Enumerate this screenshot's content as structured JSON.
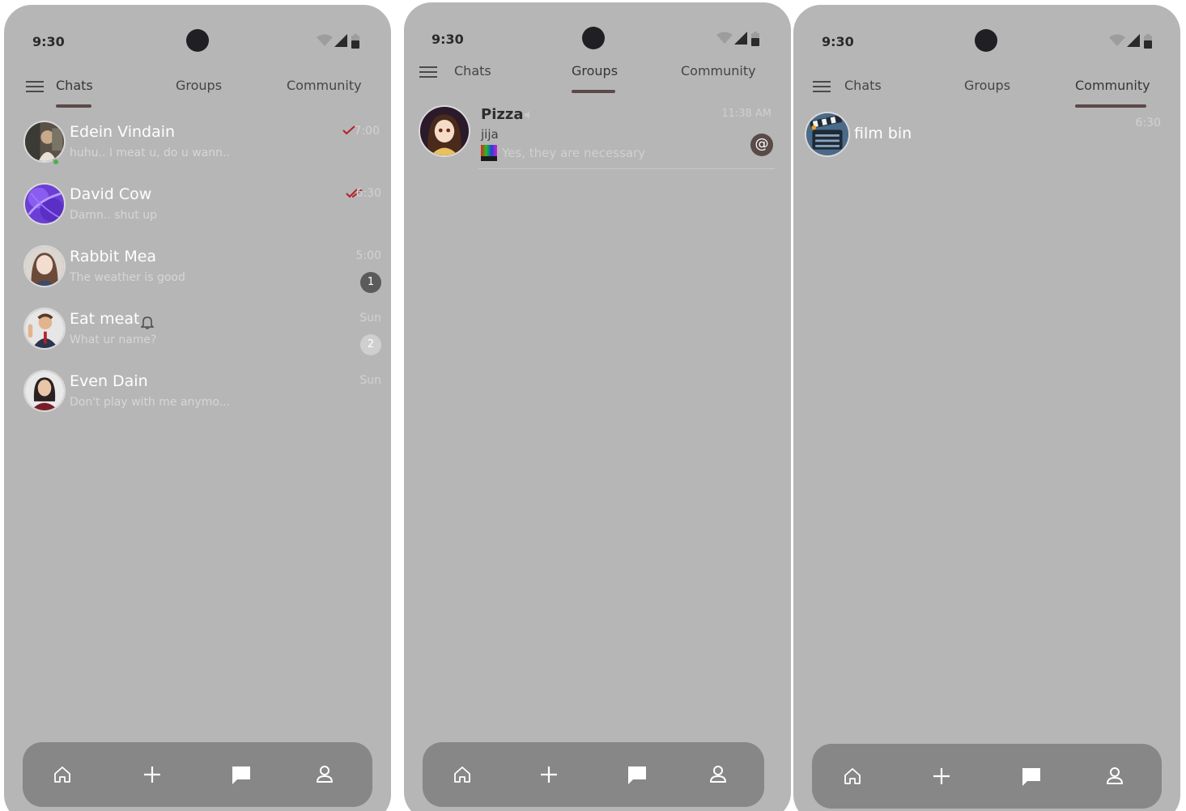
{
  "status": {
    "time": "9:30"
  },
  "tabs": {
    "chats": "Chats",
    "groups": "Groups",
    "community": "Community"
  },
  "screen1": {
    "active_tab": "chats",
    "chats": [
      {
        "name": "Edein Vindain",
        "preview": "huhu.. I meat u, do u wann..",
        "time": "7:00",
        "status": "sent",
        "online": true
      },
      {
        "name": "David Cow",
        "preview": "Damn.. shut up",
        "time": "6:30",
        "status": "read"
      },
      {
        "name": "Rabbit Mea",
        "preview": "The weather is good",
        "time": "5:00",
        "unread": "1"
      },
      {
        "name": "Eat meat",
        "preview": "What ur name?",
        "time": "Sun",
        "unread": "2",
        "muted_icon": "bell-icon"
      },
      {
        "name": "Even Dain",
        "preview": "Don't play with me anymo...",
        "time": "Sun"
      }
    ]
  },
  "screen2": {
    "active_tab": "groups",
    "group": {
      "name": "Pizza",
      "sender": "jija",
      "preview": "Yes, they are necessary",
      "time": "11:38 AM",
      "mention": "@"
    }
  },
  "screen3": {
    "active_tab": "community",
    "community": {
      "name": "film bin",
      "time": "6:30"
    }
  },
  "bottom_nav": [
    "home-icon",
    "plus-icon",
    "chat-bubble-icon",
    "user-icon"
  ],
  "colors": {
    "screen_bg": "#b6b6b6",
    "nav_bg": "#878787",
    "accent": "#5b4a48",
    "tick_red": "#b3202a",
    "online": "#4caf50"
  }
}
